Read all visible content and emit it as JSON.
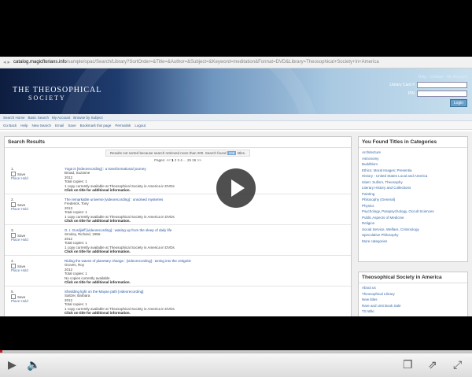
{
  "browser": {
    "url_host": "catalog.magicflorians.info",
    "url_rest": "/sample/opac/Search/Library?SortOrder=&Title=&Author=&Subject=&Keyword=meditation&Format=DVD&Library=Theosophical+Society+in+America"
  },
  "header": {
    "logo_line1": "THE THEOSOPHICAL",
    "logo_line2": "SOCIETY",
    "login_link": "Help · Contact · My Account",
    "card_label": "Library Card #",
    "pin_label": "PIN",
    "login_button": "Login"
  },
  "tabs": [
    "Search Home",
    "Basic Search",
    "My Account",
    "Browse by Subject"
  ],
  "tools": [
    "Go Back",
    "Help",
    "New Search",
    "Email",
    "Save",
    "Bookmark this page",
    "Permalink",
    "Logout"
  ],
  "results": {
    "heading": "Search Results",
    "notice_pre": "Results not sorted because search retrieved more than 200. Search found",
    "notice_count": "338",
    "notice_post": "titles.",
    "pager_label": "Pages:",
    "pager_prev": "<<",
    "pager_current": "1",
    "pager_pages": "2  3  4 ... 25  26",
    "pager_next": ">>",
    "save_label": "Save",
    "hold_label": "Place Hold",
    "records": [
      {
        "num": "1.",
        "title": "Yoga is [videorecording] : a transformational journey",
        "author": "Broad, Suzanne",
        "year": "2012",
        "copies": "Total copies: 1",
        "avail": "1 copy currently available at Theosophical Society in America in DVDs",
        "click": "Click on title for additional information."
      },
      {
        "num": "2.",
        "title": "The remarkable universe [videorecording] : unsolved mysteries",
        "author": "Frederick, Tony",
        "year": "2013",
        "copies": "Total copies: 1",
        "avail": "1 copy currently available at Theosophical Society in America in DVDs",
        "click": "Click on title for additional information."
      },
      {
        "num": "3.",
        "title": "G. I. Gurdjieff [videorecording] : waking up from the sleep of daily life",
        "author": "Smoley, Richard, 1956-",
        "year": "2012",
        "copies": "Total copies: 1",
        "avail": "1 copy currently available at Theosophical Society in America in DVDs",
        "click": "Click on title for additional information."
      },
      {
        "num": "4.",
        "title": "Riding the waves of planetary change : [videorecording] : tuning into the zeitgeist",
        "author": "Groves, Roy",
        "year": "2012",
        "copies": "Total copies: 1",
        "avail": "No copies currently available",
        "click": "Click on title for additional information."
      },
      {
        "num": "5.",
        "title": "Shedding light on the Mayan path [videorecording]",
        "author": "Saltzer, Barbara",
        "year": "2012",
        "copies": "Total copies: 1",
        "avail": "1 copy currently available at Theosophical Society in America in DVDs",
        "click": "Click on title for additional information."
      }
    ]
  },
  "categories": {
    "heading": "You Found Titles in Categories",
    "items": [
      "Architecture",
      "Astronomy",
      "Buddhism",
      "Ethics; Moral Images; Presentia",
      "History - United States Local and America",
      "Islam: Sufism, Theosophy",
      "Literary History and Collections",
      "Painting",
      "Philosophy (General)",
      "Physics",
      "Psychology, Parapsychology, Occult Sciences",
      "Public Aspects of Medicine",
      "Religion",
      "Social Service, Welfare, Criminology",
      "Speculative Philosophy",
      "More categories"
    ]
  },
  "society": {
    "heading": "Theosophical Society in America",
    "items": [
      "About us",
      "Theosophical Library",
      "New titles",
      "Rare and Unit Book Sale",
      "TS Wiki"
    ]
  },
  "player": {
    "progress_percent": 0.5,
    "play_icon": "play-icon",
    "volume_icon": "volume-icon"
  }
}
